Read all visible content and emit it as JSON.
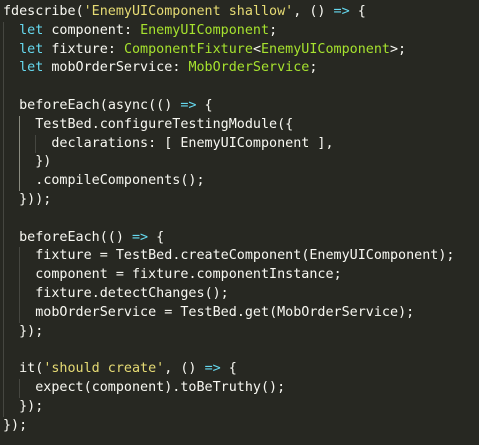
{
  "editor": {
    "background": "#272822",
    "lines": [
      {
        "indent": 0,
        "tokens": [
          [
            "fdescribe",
            "plain"
          ],
          [
            "(",
            "punct"
          ],
          [
            "'EnemyUIComponent shallow'",
            "string"
          ],
          [
            ", () ",
            "punct"
          ],
          [
            "=>",
            "keyword"
          ],
          [
            " {",
            "punct"
          ]
        ]
      },
      {
        "indent": 1,
        "tokens": [
          [
            "let",
            "keyword"
          ],
          [
            " ",
            "plain"
          ],
          [
            "component",
            "var"
          ],
          [
            ": ",
            "punct"
          ],
          [
            "EnemyUIComponent",
            "class"
          ],
          [
            ";",
            "punct"
          ]
        ]
      },
      {
        "indent": 1,
        "tokens": [
          [
            "let",
            "keyword"
          ],
          [
            " ",
            "plain"
          ],
          [
            "fixture",
            "var"
          ],
          [
            ": ",
            "punct"
          ],
          [
            "ComponentFixture",
            "class"
          ],
          [
            "<",
            "punct"
          ],
          [
            "EnemyUIComponent",
            "class"
          ],
          [
            ">;",
            "punct"
          ]
        ]
      },
      {
        "indent": 1,
        "tokens": [
          [
            "let",
            "keyword"
          ],
          [
            " ",
            "plain"
          ],
          [
            "mobOrderService",
            "var"
          ],
          [
            ": ",
            "punct"
          ],
          [
            "MobOrderService",
            "class"
          ],
          [
            ";",
            "punct"
          ]
        ]
      },
      {
        "indent": 1,
        "tokens": []
      },
      {
        "indent": 1,
        "tokens": [
          [
            "beforeEach",
            "plain"
          ],
          [
            "(",
            "punct"
          ],
          [
            "async",
            "plain"
          ],
          [
            "(() ",
            "punct"
          ],
          [
            "=>",
            "keyword"
          ],
          [
            " {",
            "punct"
          ]
        ]
      },
      {
        "indent": 2,
        "tokens": [
          [
            "TestBed",
            "plain"
          ],
          [
            ".",
            "punct"
          ],
          [
            "configureTestingModule",
            "plain"
          ],
          [
            "({",
            "punct"
          ]
        ]
      },
      {
        "indent": 3,
        "tokens": [
          [
            "declarations",
            "plain"
          ],
          [
            ": [ ",
            "punct"
          ],
          [
            "EnemyUIComponent",
            "plain"
          ],
          [
            " ],",
            "punct"
          ]
        ]
      },
      {
        "indent": 2,
        "tokens": [
          [
            "})",
            "punct"
          ]
        ]
      },
      {
        "indent": 2,
        "tokens": [
          [
            ".",
            "punct"
          ],
          [
            "compileComponents",
            "plain"
          ],
          [
            "();",
            "punct"
          ]
        ]
      },
      {
        "indent": 1,
        "tokens": [
          [
            "}));",
            "punct"
          ]
        ]
      },
      {
        "indent": 1,
        "tokens": []
      },
      {
        "indent": 1,
        "tokens": [
          [
            "beforeEach",
            "plain"
          ],
          [
            "(() ",
            "punct"
          ],
          [
            "=>",
            "keyword"
          ],
          [
            " {",
            "punct"
          ]
        ]
      },
      {
        "indent": 2,
        "tokens": [
          [
            "fixture",
            "plain"
          ],
          [
            " = ",
            "punct"
          ],
          [
            "TestBed",
            "plain"
          ],
          [
            ".",
            "punct"
          ],
          [
            "createComponent",
            "plain"
          ],
          [
            "(",
            "punct"
          ],
          [
            "EnemyUIComponent",
            "plain"
          ],
          [
            ");",
            "punct"
          ]
        ]
      },
      {
        "indent": 2,
        "tokens": [
          [
            "component",
            "plain"
          ],
          [
            " = ",
            "punct"
          ],
          [
            "fixture",
            "plain"
          ],
          [
            ".",
            "punct"
          ],
          [
            "componentInstance",
            "plain"
          ],
          [
            ";",
            "punct"
          ]
        ]
      },
      {
        "indent": 2,
        "tokens": [
          [
            "fixture",
            "plain"
          ],
          [
            ".",
            "punct"
          ],
          [
            "detectChanges",
            "plain"
          ],
          [
            "();",
            "punct"
          ]
        ]
      },
      {
        "indent": 2,
        "tokens": [
          [
            "mobOrderService",
            "plain"
          ],
          [
            " = ",
            "punct"
          ],
          [
            "TestBed",
            "plain"
          ],
          [
            ".",
            "punct"
          ],
          [
            "get",
            "plain"
          ],
          [
            "(",
            "punct"
          ],
          [
            "MobOrderService",
            "plain"
          ],
          [
            ");",
            "punct"
          ]
        ]
      },
      {
        "indent": 1,
        "tokens": [
          [
            "});",
            "punct"
          ]
        ]
      },
      {
        "indent": 1,
        "tokens": []
      },
      {
        "indent": 1,
        "tokens": [
          [
            "it",
            "plain"
          ],
          [
            "(",
            "punct"
          ],
          [
            "'should create'",
            "string"
          ],
          [
            ", () ",
            "punct"
          ],
          [
            "=>",
            "keyword"
          ],
          [
            " {",
            "punct"
          ]
        ]
      },
      {
        "indent": 2,
        "tokens": [
          [
            "expect",
            "plain"
          ],
          [
            "(",
            "punct"
          ],
          [
            "component",
            "plain"
          ],
          [
            ").",
            "punct"
          ],
          [
            "toBeTruthy",
            "plain"
          ],
          [
            "();",
            "punct"
          ]
        ]
      },
      {
        "indent": 1,
        "tokens": [
          [
            "});",
            "punct"
          ]
        ]
      },
      {
        "indent": 0,
        "tokens": [
          [
            "});",
            "punct"
          ]
        ]
      }
    ]
  }
}
